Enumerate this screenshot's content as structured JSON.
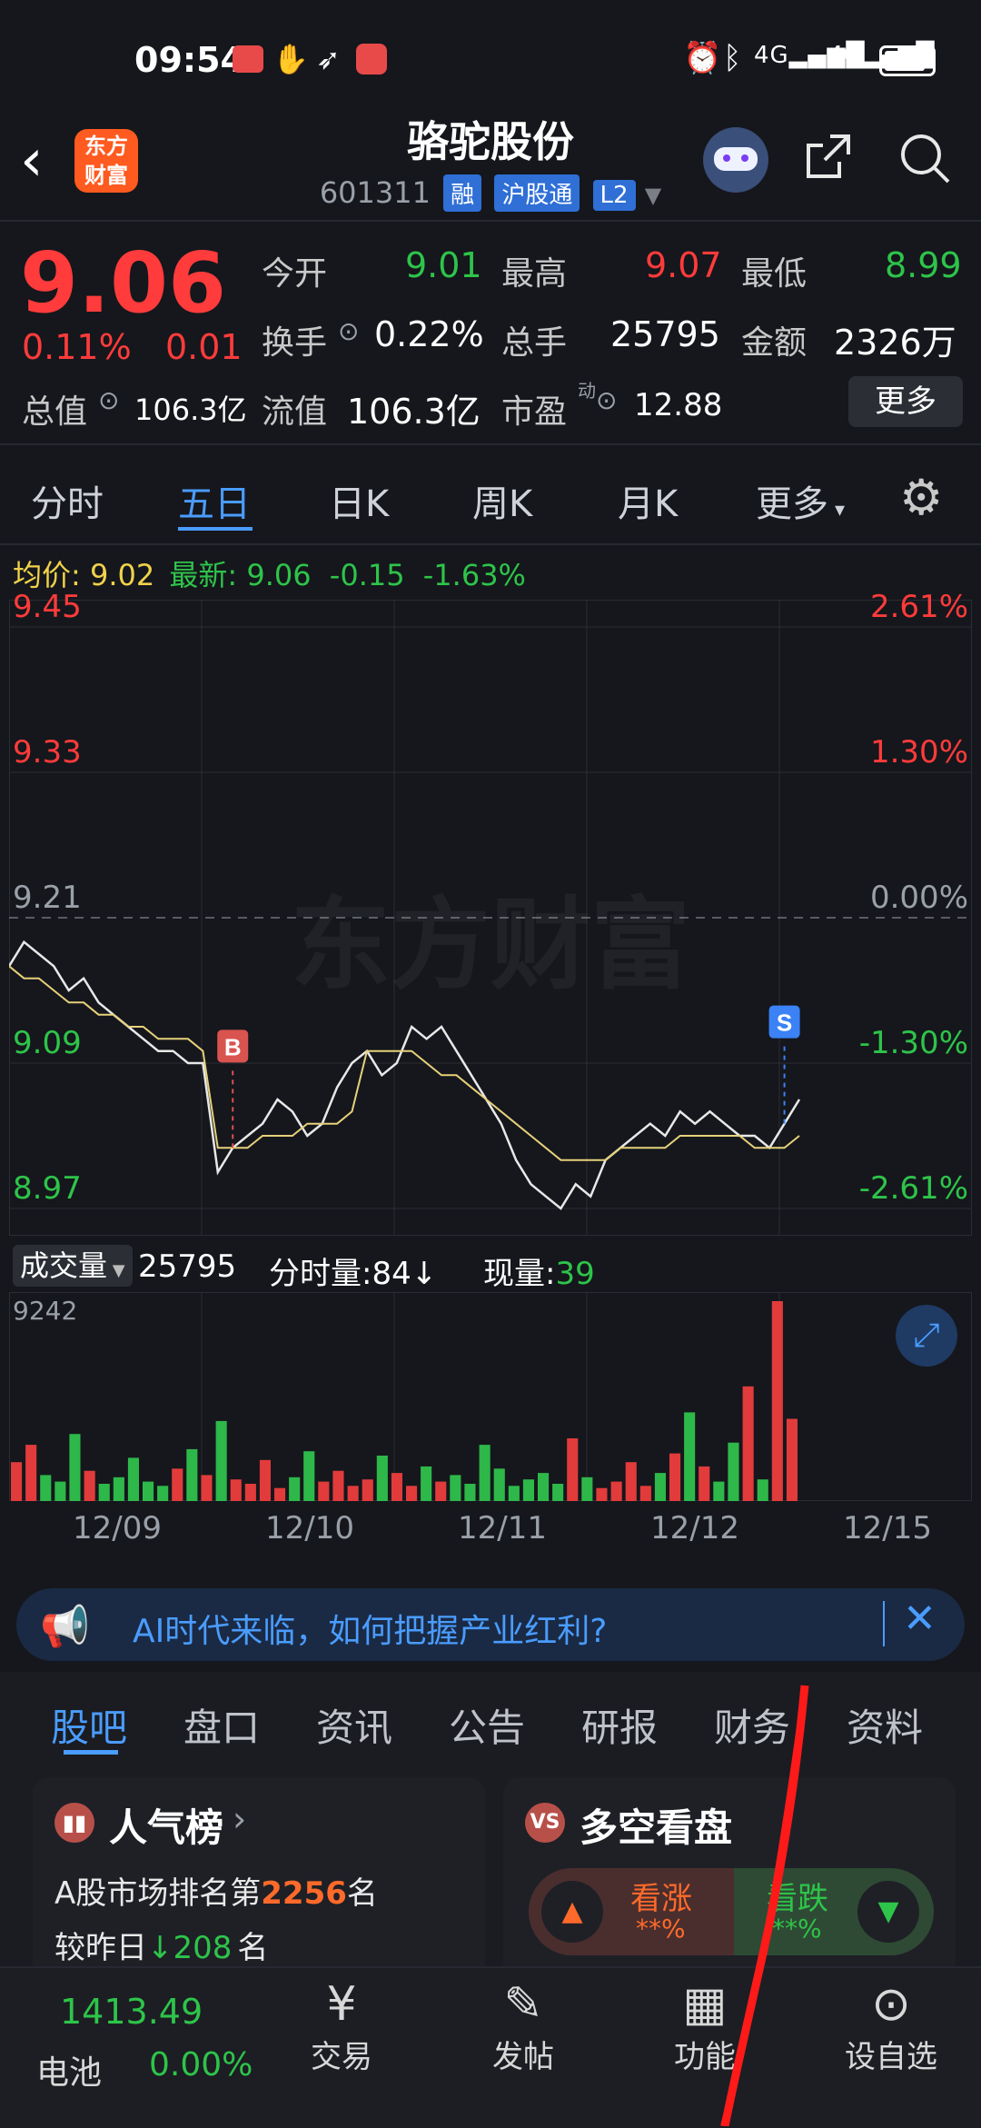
{
  "status_bar": {
    "time": "09:54",
    "battery_icon": "battery-icon"
  },
  "header": {
    "brand": "东方财富",
    "stock_name": "骆驼股份",
    "code": "601311",
    "tags": [
      "融",
      "沪股通",
      "L2"
    ]
  },
  "quote": {
    "price": "9.06",
    "pct": "0.11%",
    "chg": "0.01",
    "open_label": "今开",
    "open": "9.01",
    "high_label": "最高",
    "high": "9.07",
    "low_label": "最低",
    "low": "8.99",
    "turnover_label": "换手",
    "turnover": "0.22%",
    "volume_label": "总手",
    "volume": "25795",
    "amount_label": "金额",
    "amount": "2326万",
    "mktcap_label": "总值",
    "mktcap": "106.3亿",
    "float_label": "流值",
    "float": "106.3亿",
    "pe_label": "市盈",
    "pe_sup": "动",
    "pe": "12.88",
    "more_button": "更多"
  },
  "chart_tabs": [
    "分时",
    "五日",
    "日K",
    "周K",
    "月K",
    "更多"
  ],
  "chart_info": {
    "avg_label": "均价:",
    "avg": "9.02",
    "latest_label": "最新:",
    "latest": "9.06",
    "chg": "-0.15",
    "pct": "-1.63%"
  },
  "volume_info": {
    "selector": "成交量",
    "total": "25795",
    "tick_label": "分时量:",
    "tick": "84↓",
    "now_label": "现量:",
    "now": "39",
    "max": "9242"
  },
  "watermark": "东方财富",
  "markers": {
    "buy": "B",
    "sell": "S"
  },
  "chart_data": {
    "type": "line",
    "title": "",
    "x_tick_labels": [
      "12/09",
      "12/10",
      "12/11",
      "12/12",
      "12/15"
    ],
    "y_left_ticks": [
      "9.45",
      "9.33",
      "9.21",
      "9.09",
      "8.97"
    ],
    "y_right_ticks": [
      "2.61%",
      "1.30%",
      "0.00%",
      "-1.30%",
      "-2.61%"
    ],
    "ylim": [
      8.97,
      9.45
    ],
    "prev_close": 9.21,
    "series": [
      {
        "values": [
          9.17,
          9.19,
          9.18,
          9.17,
          9.15,
          9.16,
          9.14,
          9.13,
          9.12,
          9.11,
          9.1,
          9.1,
          9.09,
          9.09,
          9.0,
          9.02,
          9.03,
          9.04,
          9.06,
          9.05,
          9.03,
          9.04,
          9.07,
          9.09,
          9.1,
          9.08,
          9.09,
          9.12,
          9.11,
          9.12,
          9.1,
          9.08,
          9.06,
          9.04,
          9.01,
          8.99,
          8.98,
          8.97,
          8.99,
          8.98,
          9.01,
          9.02,
          9.03,
          9.04,
          9.03,
          9.05,
          9.04,
          9.05,
          9.04,
          9.03,
          9.03,
          9.02,
          9.04,
          9.06
        ]
      },
      {
        "values": [
          9.17,
          9.16,
          9.16,
          9.15,
          9.14,
          9.14,
          9.13,
          9.13,
          9.12,
          9.12,
          9.11,
          9.11,
          9.11,
          9.1,
          9.02,
          9.02,
          9.02,
          9.03,
          9.03,
          9.03,
          9.04,
          9.04,
          9.04,
          9.05,
          9.1,
          9.1,
          9.1,
          9.1,
          9.09,
          9.08,
          9.08,
          9.07,
          9.06,
          9.05,
          9.04,
          9.03,
          9.02,
          9.01,
          9.01,
          9.01,
          9.01,
          9.02,
          9.02,
          9.02,
          9.02,
          9.03,
          9.03,
          9.03,
          9.03,
          9.03,
          9.02,
          9.02,
          9.02,
          9.03
        ]
      }
    ],
    "volume_max": 9242,
    "volumes": [
      1800,
      2600,
      1200,
      900,
      3100,
      1400,
      800,
      1100,
      2000,
      900,
      700,
      1500,
      2400,
      1200,
      3700,
      1000,
      800,
      1900,
      600,
      1100,
      2300,
      900,
      1400,
      700,
      1000,
      2100,
      1300,
      700,
      1600,
      900,
      1200,
      800,
      2600,
      1500,
      700,
      1000,
      1300,
      800,
      2900,
      1100,
      600,
      900,
      1800,
      700,
      1300,
      2200,
      4100,
      1600,
      900,
      2700,
      5300,
      1000,
      9242,
      3800
    ]
  },
  "ad_banner": {
    "text": "AI时代来临，如何把握产业红利?"
  },
  "section_tabs": [
    "股吧",
    "盘口",
    "资讯",
    "公告",
    "研报",
    "财务",
    "资料"
  ],
  "popularity_card": {
    "title": "人气榜",
    "line1_prefix": "A股市场排名第",
    "rank": "2256",
    "line1_suffix": "名",
    "line2_prefix": "较昨日",
    "change": "208",
    "line2_suffix": "名"
  },
  "vs_card": {
    "title": "多空看盘",
    "bull": "看涨",
    "bull_pct": "**%",
    "bear": "看跌",
    "bear_pct": "**%"
  },
  "bottom_nav": {
    "index_value": "1413.49",
    "index_label": "电池",
    "index_pct": "0.00%",
    "items": [
      "交易",
      "发帖",
      "功能",
      "设自选"
    ]
  },
  "colors": {
    "up": "#ff3b3b",
    "down": "#2ec44a",
    "accent": "#4a9cff",
    "avg_line": "#e6d17a"
  }
}
